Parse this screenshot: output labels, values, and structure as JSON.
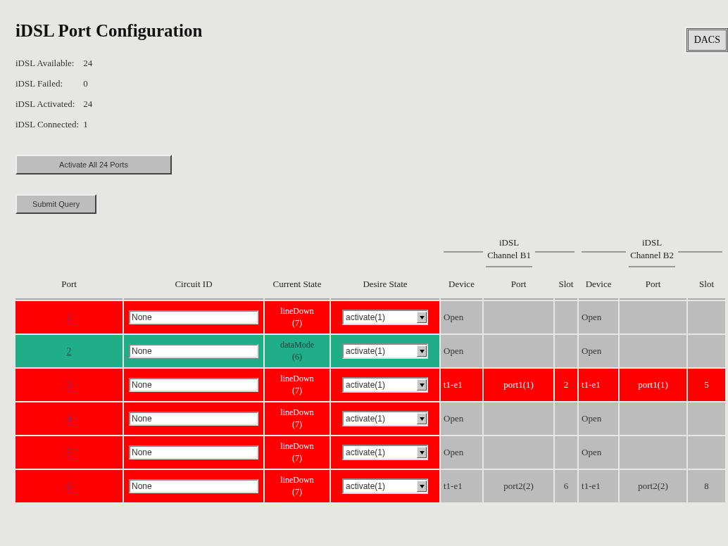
{
  "title": "iDSL Port Configuration",
  "dacs_button": "DACS",
  "stats": [
    {
      "label": "iDSL Available:",
      "value": "24"
    },
    {
      "label": "iDSL Failed:",
      "value": "0"
    },
    {
      "label": "iDSL Activated:",
      "value": "24"
    },
    {
      "label": "iDSL Connected:",
      "value": "1"
    }
  ],
  "buttons": [
    "Activate All 24 Ports",
    "Submit Query"
  ],
  "table": {
    "group_headers": [
      {
        "line1": "iDSL",
        "line2": "Channel B1"
      },
      {
        "line1": "iDSL",
        "line2": "Channel B2"
      }
    ],
    "columns": [
      "Port",
      "Circuit ID",
      "Current State",
      "Desire State",
      "Device",
      "Port",
      "Slot",
      "Device",
      "Port",
      "Slot"
    ],
    "rows": [
      {
        "port": "1",
        "circuit_id": "None",
        "state": "lineDown",
        "state_code": "(7)",
        "kind": "down",
        "desire": "activate(1)",
        "channels": [
          {
            "device": "Open",
            "highlighted": false
          },
          {
            "device": "Open",
            "highlighted": false
          }
        ]
      },
      {
        "port": "2",
        "circuit_id": "None",
        "state": "dataMode",
        "state_code": "(6)",
        "kind": "data",
        "desire": "activate(1)",
        "channels": [
          {
            "device": "Open",
            "highlighted": false
          },
          {
            "device": "Open",
            "highlighted": false
          }
        ]
      },
      {
        "port": "3",
        "circuit_id": "None",
        "state": "lineDown",
        "state_code": "(7)",
        "kind": "down",
        "desire": "activate(1)",
        "channels": [
          {
            "device": "t1-e1",
            "port": "port1(1)",
            "slot": "2",
            "highlighted": true
          },
          {
            "device": "t1-e1",
            "port": "port1(1)",
            "slot": "5",
            "highlighted": true
          }
        ]
      },
      {
        "port": "4",
        "circuit_id": "None",
        "state": "lineDown",
        "state_code": "(7)",
        "kind": "down",
        "desire": "activate(1)",
        "channels": [
          {
            "device": "Open",
            "highlighted": false
          },
          {
            "device": "Open",
            "highlighted": false
          }
        ]
      },
      {
        "port": "5",
        "circuit_id": "None",
        "state": "lineDown",
        "state_code": "(7)",
        "kind": "down",
        "desire": "activate(1)",
        "channels": [
          {
            "device": "Open",
            "highlighted": false
          },
          {
            "device": "Open",
            "highlighted": false
          }
        ]
      },
      {
        "port": "6",
        "circuit_id": "None",
        "state": "lineDown",
        "state_code": "(7)",
        "kind": "down",
        "desire": "activate(1)",
        "channels": [
          {
            "device": "t1-e1",
            "port": "port2(2)",
            "slot": "6",
            "highlighted": false
          },
          {
            "device": "t1-e1",
            "port": "port2(2)",
            "slot": "8",
            "highlighted": false
          }
        ]
      }
    ]
  }
}
